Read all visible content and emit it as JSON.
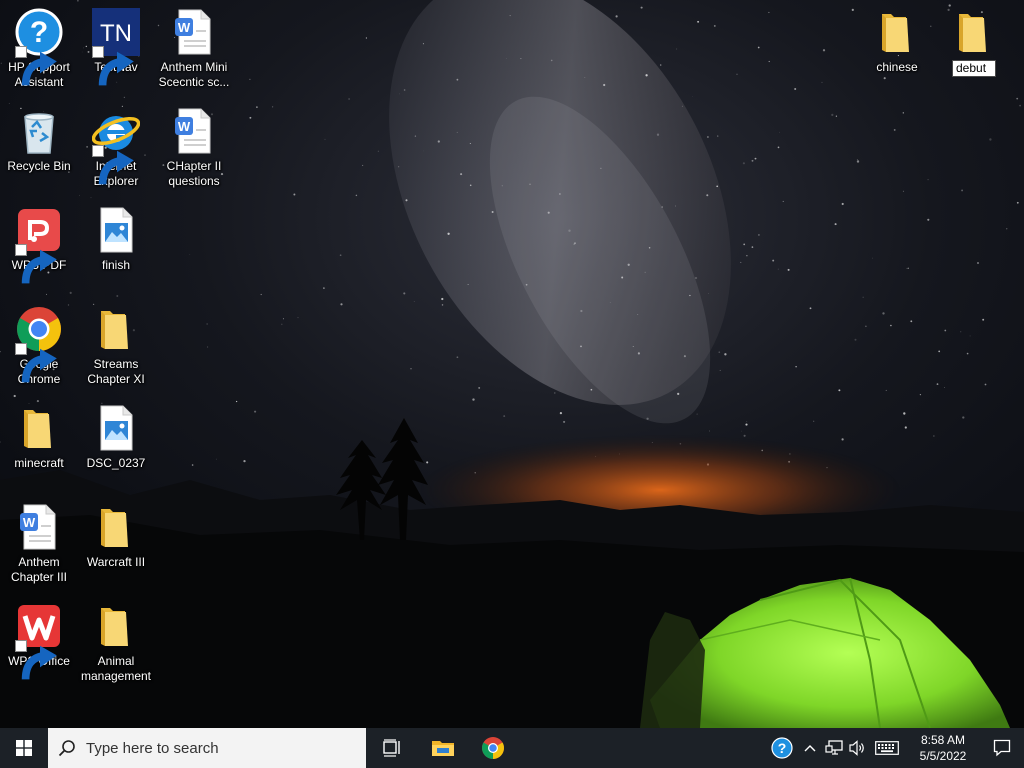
{
  "desktop": {
    "left_icons": [
      {
        "label": "HP Support\nAssistant",
        "icon": "help-icon",
        "shortcut": true
      },
      {
        "label": "TestNav",
        "icon": "testnav-icon",
        "shortcut": true
      },
      {
        "label": "Anthem Mini\nScecntic sc...",
        "icon": "word-document-icon",
        "shortcut": false
      },
      {
        "label": "Recycle Bin",
        "icon": "recycle-bin-icon",
        "shortcut": false
      },
      {
        "label": "Internet\nExplorer",
        "icon": "internet-explorer-icon",
        "shortcut": true
      },
      {
        "label": "CHapter II\nquestions",
        "icon": "word-document-icon",
        "shortcut": false
      },
      {
        "label": "WPS PDF",
        "icon": "wps-pdf-icon",
        "shortcut": true
      },
      {
        "label": "finish",
        "icon": "image-file-icon",
        "shortcut": false
      },
      {
        "label": "Google\nChrome",
        "icon": "chrome-icon",
        "shortcut": true
      },
      {
        "label": "Streams\nChapter XI",
        "icon": "folder-icon",
        "shortcut": false
      },
      {
        "label": "minecraft",
        "icon": "folder-icon",
        "shortcut": false
      },
      {
        "label": "DSC_0237",
        "icon": "image-file-icon",
        "shortcut": false
      },
      {
        "label": "Anthem\nChapter III",
        "icon": "word-document-icon",
        "shortcut": false
      },
      {
        "label": "Warcraft III",
        "icon": "folder-icon",
        "shortcut": false
      },
      {
        "label": "WPS Office",
        "icon": "wps-office-icon",
        "shortcut": true
      },
      {
        "label": "Animal\nmanagement",
        "icon": "folder-icon",
        "shortcut": false
      }
    ],
    "right_icons": {
      "chinese": {
        "label": "chinese",
        "icon": "folder-icon"
      },
      "debut": {
        "rename_value": "debut",
        "icon": "folder-icon"
      }
    },
    "testnav_text": "TN"
  },
  "taskbar": {
    "search_placeholder": "Type here to search",
    "clock_time": "8:58 AM",
    "clock_date": "5/5/2022"
  },
  "colors": {
    "taskbar_bg": "#1c2127",
    "folder_yellow": "#f8d775",
    "tent_green": "#8ee63a"
  }
}
